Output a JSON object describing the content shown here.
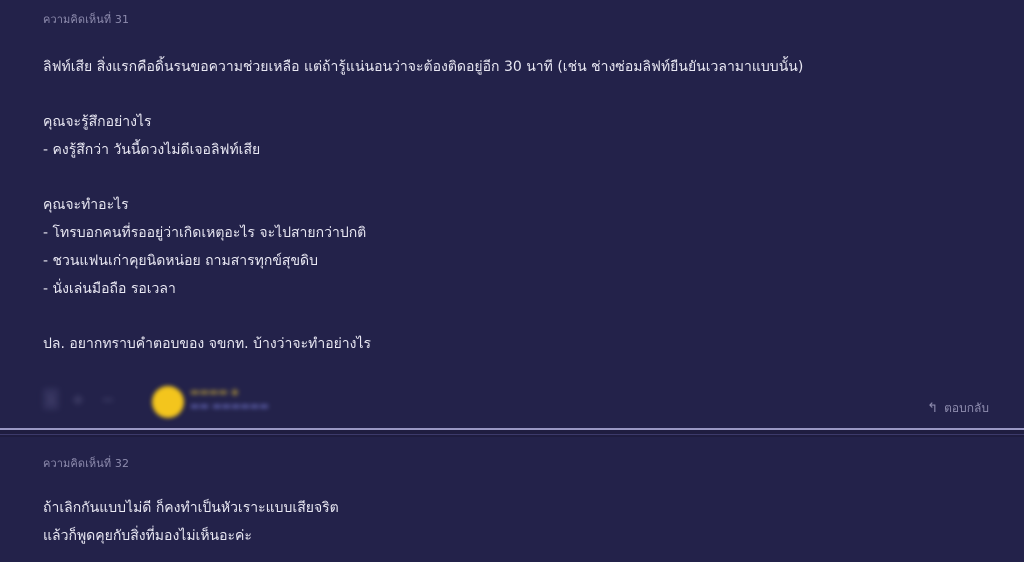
{
  "comments": [
    {
      "label": "ความคิดเห็นที่ 31",
      "lines": [
        "ลิฟท์เสีย สิ่งแรกคือดิ้นรนขอความช่วยเหลือ แต่ถ้ารู้แน่นอนว่าจะต้องติดอยู่อีก 30 นาที (เช่น ช่างซ่อมลิฟท์ยืนยันเวลามาแบบนั้น)",
        "คุณจะรู้สึกอย่างไร",
        "- คงรู้สึกว่า วันนี้ดวงไม่ดีเจอลิฟท์เสีย",
        "คุณจะทำอะไร",
        "- โทรบอกคนที่รออยู่ว่าเกิดเหตุอะไร จะไปสายกว่าปกติ",
        "- ชวนแฟนเก่าคุยนิดหน่อย ถามสารทุกข์สุขดิบ",
        "- นั่งเล่นมือถือ รอเวลา",
        "ปล. อยากทราบคำตอบของ จขกท. บ้างว่าจะทำอย่างไร"
      ],
      "reply_label": "ตอบกลับ",
      "vote_count": "1"
    },
    {
      "label": "ความคิดเห็นที่ 32",
      "lines": [
        "ถ้าเลิกกันแบบไม่ดี ก็คงทำเป็นหัวเราะแบบเสียจริต",
        "แล้วก็พูดคุยกับสิ่งที่มองไม่เห็นอะค่ะ"
      ]
    }
  ],
  "colors": {
    "page_bg": "#1f1d40",
    "card_bg": "#23224a",
    "text": "#e9e8f3",
    "muted": "#8e8cae",
    "avatar": "#f3c51d",
    "divider": "#9a98c4"
  },
  "icons": {
    "reply": "reply-arrow-icon",
    "upvote": "plus-icon",
    "downvote": "minus-icon"
  }
}
